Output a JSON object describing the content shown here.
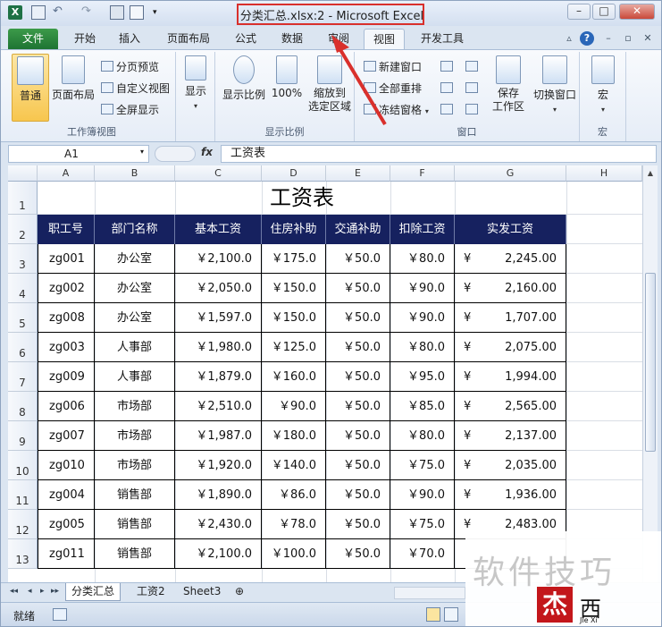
{
  "window": {
    "title": "分类汇总.xlsx:2  -  Microsoft Excel"
  },
  "tabs": [
    "文件",
    "开始",
    "插入",
    "页面布局",
    "公式",
    "数据",
    "审阅",
    "视图",
    "开发工具"
  ],
  "ribbon": {
    "workbook_views": {
      "normal": "普通",
      "page_layout": "页面布局",
      "page_break": "分页预览",
      "custom_views": "自定义视图",
      "full_screen": "全屏显示",
      "label": "工作簿视图"
    },
    "show": {
      "label_btn": "显示"
    },
    "zoom": {
      "zoom_btn": "显示比例",
      "pct_btn": "100%",
      "zoom_sel_line1": "缩放到",
      "zoom_sel_line2": "选定区域",
      "label": "显示比例"
    },
    "window": {
      "new_window": "新建窗口",
      "arrange_all": "全部重排",
      "freeze_panes": "冻结窗格",
      "save_ws_line1": "保存",
      "save_ws_line2": "工作区",
      "switch_windows": "切换窗口",
      "label": "窗口"
    },
    "macros": {
      "macro_btn": "宏",
      "label": "宏"
    }
  },
  "formula_bar": {
    "name_box": "A1",
    "fx": "fx",
    "content": "工资表"
  },
  "columns": [
    "A",
    "B",
    "C",
    "D",
    "E",
    "F",
    "G",
    "H"
  ],
  "rows": [
    "1",
    "2",
    "3",
    "4",
    "5",
    "6",
    "7",
    "8",
    "9",
    "10",
    "11",
    "12",
    "13"
  ],
  "sheet": {
    "title": "工资表",
    "headers": [
      "职工号",
      "部门名称",
      "基本工资",
      "住房补助",
      "交通补助",
      "扣除工资",
      "实发工资"
    ],
    "data": [
      [
        "zg001",
        "办公室",
        "￥2,100.0",
        "￥175.0",
        "￥50.0",
        "￥80.0",
        "¥",
        "2,245.00"
      ],
      [
        "zg002",
        "办公室",
        "￥2,050.0",
        "￥150.0",
        "￥50.0",
        "￥90.0",
        "¥",
        "2,160.00"
      ],
      [
        "zg008",
        "办公室",
        "￥1,597.0",
        "￥150.0",
        "￥50.0",
        "￥90.0",
        "¥",
        "1,707.00"
      ],
      [
        "zg003",
        "人事部",
        "￥1,980.0",
        "￥125.0",
        "￥50.0",
        "￥80.0",
        "¥",
        "2,075.00"
      ],
      [
        "zg009",
        "人事部",
        "￥1,879.0",
        "￥160.0",
        "￥50.0",
        "￥95.0",
        "¥",
        "1,994.00"
      ],
      [
        "zg006",
        "市场部",
        "￥2,510.0",
        "￥90.0",
        "￥50.0",
        "￥85.0",
        "¥",
        "2,565.00"
      ],
      [
        "zg007",
        "市场部",
        "￥1,987.0",
        "￥180.0",
        "￥50.0",
        "￥80.0",
        "¥",
        "2,137.00"
      ],
      [
        "zg010",
        "市场部",
        "￥1,920.0",
        "￥140.0",
        "￥50.0",
        "￥75.0",
        "¥",
        "2,035.00"
      ],
      [
        "zg004",
        "销售部",
        "￥1,890.0",
        "￥86.0",
        "￥50.0",
        "￥90.0",
        "¥",
        "1,936.00"
      ],
      [
        "zg005",
        "销售部",
        "￥2,430.0",
        "￥78.0",
        "￥50.0",
        "￥75.0",
        "¥",
        "2,483.00"
      ],
      [
        "zg011",
        "销售部",
        "￥2,100.0",
        "￥100.0",
        "￥50.0",
        "￥70.0",
        "",
        ""
      ]
    ]
  },
  "sheet_tabs": [
    "分类汇总",
    "工资2",
    "Sheet3"
  ],
  "status": {
    "ready": "就绪"
  },
  "watermark": {
    "text": "软件技巧",
    "logo": "杰",
    "logo2": "西",
    "sub": "Jie Xi"
  },
  "colors": {
    "header_bg": "#16215f",
    "highlight": "#d9302c",
    "file_tab": "#1e7433"
  }
}
